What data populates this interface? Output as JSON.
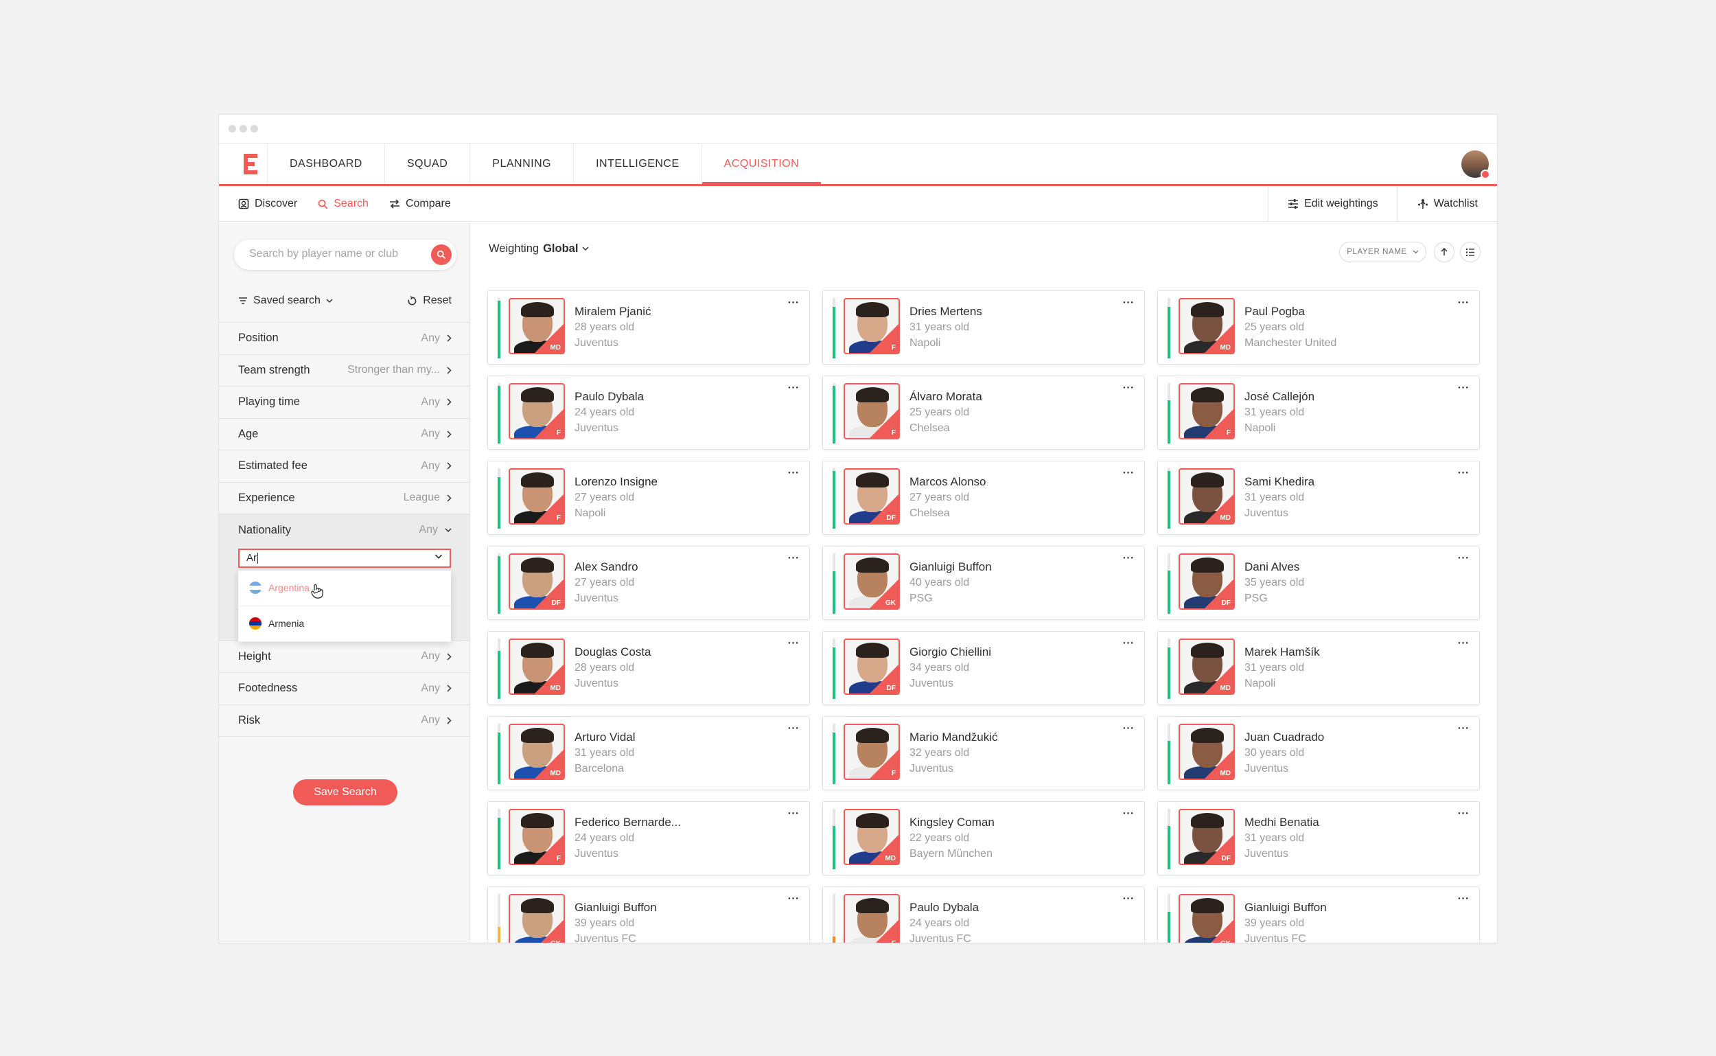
{
  "nav": {
    "tabs": [
      {
        "label": "DASHBOARD",
        "active": false
      },
      {
        "label": "SQUAD",
        "active": false
      },
      {
        "label": "PLANNING",
        "active": false
      },
      {
        "label": "INTELLIGENCE",
        "active": false
      },
      {
        "label": "ACQUISITION",
        "active": true
      }
    ]
  },
  "subnav": {
    "discover": "Discover",
    "search": "Search",
    "compare": "Compare",
    "edit_weightings": "Edit weightings",
    "watchlist": "Watchlist"
  },
  "sidebar": {
    "search_placeholder": "Search by player name or club",
    "saved_search": "Saved search",
    "reset": "Reset",
    "filters_top": [
      {
        "label": "Position",
        "value": "Any"
      },
      {
        "label": "Team strength",
        "value": "Stronger than my..."
      },
      {
        "label": "Playing time",
        "value": "Any"
      },
      {
        "label": "Age",
        "value": "Any"
      },
      {
        "label": "Estimated fee",
        "value": "Any"
      },
      {
        "label": "Experience",
        "value": "League"
      }
    ],
    "nationality": {
      "label": "Nationality",
      "value": "Any",
      "input": "Ar"
    },
    "dropdown": [
      {
        "label": "Argentina",
        "highlighted": true
      },
      {
        "label": "Armenia",
        "highlighted": false
      }
    ],
    "filters_bottom": [
      {
        "label": "Height",
        "value": "Any"
      },
      {
        "label": "Footedness",
        "value": "Any"
      },
      {
        "label": "Risk",
        "value": "Any"
      }
    ],
    "save_search": "Save Search"
  },
  "main": {
    "weighting_label": "Weighting",
    "weighting_value": "Global",
    "sort_label": "PLAYER NAME"
  },
  "colors": {
    "accent": "#f05a57",
    "green": "#1dc47e",
    "amber": "#f4b63f",
    "orange": "#f08b2e"
  },
  "players": [
    {
      "name": "Miralem Pjanić",
      "age": "28 years old",
      "club": "Juventus",
      "pos": "MD",
      "rating": 0.95,
      "bar": "green"
    },
    {
      "name": "Dries Mertens",
      "age": "31 years old",
      "club": "Napoli",
      "pos": "F",
      "rating": 0.85,
      "bar": "green"
    },
    {
      "name": "Paul Pogba",
      "age": "25 years old",
      "club": "Manchester United",
      "pos": "MD",
      "rating": 0.85,
      "bar": "green"
    },
    {
      "name": "Paulo Dybala",
      "age": "24 years old",
      "club": "Juventus",
      "pos": "F",
      "rating": 0.95,
      "bar": "green"
    },
    {
      "name": "Álvaro Morata",
      "age": "25 years old",
      "club": "Chelsea",
      "pos": "F",
      "rating": 0.95,
      "bar": "green"
    },
    {
      "name": "José Callejón",
      "age": "31 years old",
      "club": "Napoli",
      "pos": "F",
      "rating": 0.72,
      "bar": "green"
    },
    {
      "name": "Lorenzo Insigne",
      "age": "27 years old",
      "club": "Napoli",
      "pos": "F",
      "rating": 0.85,
      "bar": "green"
    },
    {
      "name": "Marcos Alonso",
      "age": "27 years old",
      "club": "Chelsea",
      "pos": "DF",
      "rating": 0.95,
      "bar": "green"
    },
    {
      "name": "Sami Khedira",
      "age": "31 years old",
      "club": "Juventus",
      "pos": "MD",
      "rating": 0.95,
      "bar": "green"
    },
    {
      "name": "Alex Sandro",
      "age": "27 years old",
      "club": "Juventus",
      "pos": "DF",
      "rating": 0.95,
      "bar": "green"
    },
    {
      "name": "Gianluigi Buffon",
      "age": "40 years old",
      "club": "PSG",
      "pos": "GK",
      "rating": 0.7,
      "bar": "green"
    },
    {
      "name": "Dani Alves",
      "age": "35 years old",
      "club": "PSG",
      "pos": "DF",
      "rating": 0.72,
      "bar": "green"
    },
    {
      "name": "Douglas Costa",
      "age": "28 years old",
      "club": "Juventus",
      "pos": "MD",
      "rating": 0.8,
      "bar": "green"
    },
    {
      "name": "Giorgio Chiellini",
      "age": "34 years old",
      "club": "Juventus",
      "pos": "DF",
      "rating": 0.85,
      "bar": "green"
    },
    {
      "name": "Marek Hamšík",
      "age": "31 years old",
      "club": "Napoli",
      "pos": "MD",
      "rating": 0.85,
      "bar": "green"
    },
    {
      "name": "Arturo Vidal",
      "age": "31 years old",
      "club": "Barcelona",
      "pos": "MD",
      "rating": 0.85,
      "bar": "green"
    },
    {
      "name": "Mario Mandžukić",
      "age": "32 years old",
      "club": "Juventus",
      "pos": "F",
      "rating": 0.85,
      "bar": "green"
    },
    {
      "name": "Juan Cuadrado",
      "age": "30 years old",
      "club": "Juventus",
      "pos": "MD",
      "rating": 0.72,
      "bar": "green"
    },
    {
      "name": "Federico Bernarde...",
      "age": "24 years old",
      "club": "Juventus",
      "pos": "F",
      "rating": 0.85,
      "bar": "green"
    },
    {
      "name": "Kingsley Coman",
      "age": "22 years old",
      "club": "Bayern München",
      "pos": "MD",
      "rating": 0.72,
      "bar": "green"
    },
    {
      "name": "Medhi Benatia",
      "age": "31 years old",
      "club": "Juventus",
      "pos": "DF",
      "rating": 0.72,
      "bar": "green"
    },
    {
      "name": "Gianluigi Buffon",
      "age": "39 years old",
      "club": "Juventus FC",
      "pos": "GK",
      "rating": 0.45,
      "bar": "amber"
    },
    {
      "name": "Paulo Dybala",
      "age": "24 years old",
      "club": "Juventus FC",
      "pos": "F",
      "rating": 0.3,
      "bar": "orange"
    },
    {
      "name": "Gianluigi Buffon",
      "age": "39 years old",
      "club": "Juventus FC",
      "pos": "GK",
      "rating": 0.7,
      "bar": "green"
    }
  ]
}
